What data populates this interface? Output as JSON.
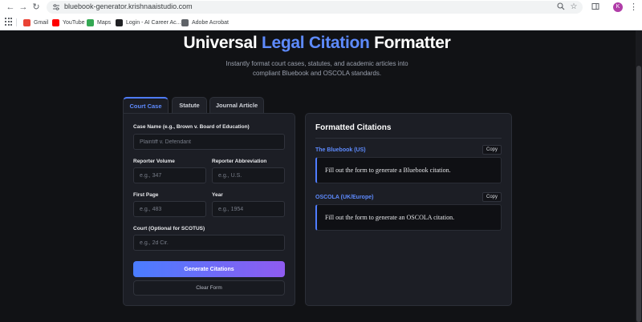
{
  "browser": {
    "url": "bluebook-generator.krishnaaistudio.com",
    "avatar_initial": "K",
    "bookmarks": [
      {
        "label": "Gmail",
        "color": "#ea4335"
      },
      {
        "label": "YouTube",
        "color": "#ff0000"
      },
      {
        "label": "Maps",
        "color": "#34a853"
      },
      {
        "label": "Login - AI Career Ac...",
        "color": "#202124"
      },
      {
        "label": "Adobe Acrobat",
        "color": "#5f6368"
      }
    ]
  },
  "hero": {
    "title_prefix": "Universal",
    "title_accent": "Legal Citation",
    "title_suffix": "Formatter",
    "subtitle": "Instantly format court cases, statutes, and academic articles into compliant Bluebook and OSCOLA standards.",
    "accent_color": "#5e8bff"
  },
  "tabs": [
    {
      "label": "Court Case",
      "active": true
    },
    {
      "label": "Statute",
      "active": false
    },
    {
      "label": "Journal Article",
      "active": false
    }
  ],
  "form": {
    "case_name": {
      "label": "Case Name (e.g., Brown v. Board of Education)",
      "placeholder": "Plaintiff v. Defendant",
      "value": ""
    },
    "reporter_volume": {
      "label": "Reporter Volume",
      "placeholder": "e.g., 347",
      "value": ""
    },
    "reporter_abbreviation": {
      "label": "Reporter Abbreviation",
      "placeholder": "e.g., U.S.",
      "value": ""
    },
    "first_page": {
      "label": "First Page",
      "placeholder": "e.g., 483",
      "value": ""
    },
    "year": {
      "label": "Year",
      "placeholder": "e.g., 1954",
      "value": ""
    },
    "court": {
      "label": "Court (Optional for SCOTUS)",
      "placeholder": "e.g., 2d Cir.",
      "value": ""
    },
    "generate_label": "Generate Citations",
    "clear_label": "Clear Form"
  },
  "output": {
    "title": "Formatted Citations",
    "bluebook": {
      "label": "The Bluebook (US)",
      "copy_label": "Copy",
      "text": "Fill out the form to generate a Bluebook citation."
    },
    "oscola": {
      "label": "OSCOLA (UK/Europe)",
      "copy_label": "Copy",
      "text": "Fill out the form to generate an OSCOLA citation."
    }
  }
}
